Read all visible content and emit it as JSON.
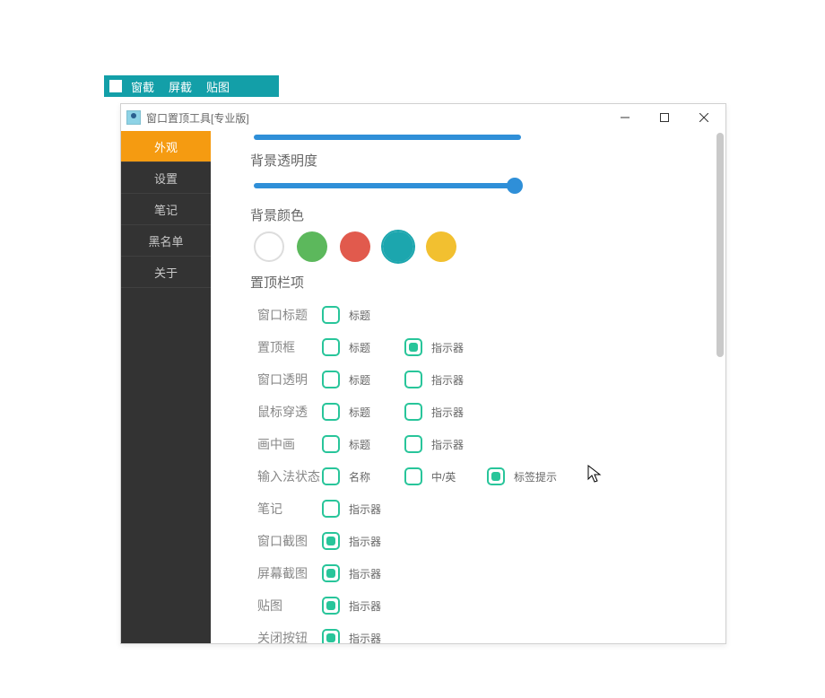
{
  "toolbar": {
    "items": [
      "窗截",
      "屏截",
      "贴图"
    ]
  },
  "window": {
    "title": "窗口置顶工具[专业版]"
  },
  "sidebar": {
    "items": [
      {
        "label": "外观",
        "active": true
      },
      {
        "label": "设置",
        "active": false
      },
      {
        "label": "笔记",
        "active": false
      },
      {
        "label": "黑名单",
        "active": false
      },
      {
        "label": "关于",
        "active": false
      }
    ]
  },
  "content": {
    "slider_bg_opacity_label": "背景透明度",
    "slider_bg_opacity_value": 100,
    "bg_color_label": "背景颜色",
    "colors": {
      "white": "#ffffff",
      "green": "#5cb85c",
      "red": "#e15a4d",
      "teal": "#1ca6ae",
      "yellow": "#f2c030",
      "selected": "teal"
    },
    "topbar_items_label": "置顶栏项",
    "rows": [
      {
        "label": "窗口标题",
        "opts": [
          {
            "label": "标题",
            "checked": false
          }
        ]
      },
      {
        "label": "置顶框",
        "opts": [
          {
            "label": "标题",
            "checked": false
          },
          {
            "label": "指示器",
            "checked": true
          }
        ]
      },
      {
        "label": "窗口透明",
        "opts": [
          {
            "label": "标题",
            "checked": false
          },
          {
            "label": "指示器",
            "checked": false
          }
        ]
      },
      {
        "label": "鼠标穿透",
        "opts": [
          {
            "label": "标题",
            "checked": false
          },
          {
            "label": "指示器",
            "checked": false
          }
        ]
      },
      {
        "label": "画中画",
        "opts": [
          {
            "label": "标题",
            "checked": false
          },
          {
            "label": "指示器",
            "checked": false
          }
        ]
      },
      {
        "label": "输入法状态",
        "opts": [
          {
            "label": "名称",
            "checked": false
          },
          {
            "label": "中/英",
            "checked": false
          },
          {
            "label": "标签提示",
            "checked": true
          }
        ]
      },
      {
        "label": "笔记",
        "opts": [
          {
            "label": "指示器",
            "checked": false
          }
        ]
      },
      {
        "label": "窗口截图",
        "opts": [
          {
            "label": "指示器",
            "checked": true
          }
        ]
      },
      {
        "label": "屏幕截图",
        "opts": [
          {
            "label": "指示器",
            "checked": true
          }
        ]
      },
      {
        "label": "贴图",
        "opts": [
          {
            "label": "指示器",
            "checked": true
          }
        ]
      },
      {
        "label": "关闭按钮",
        "opts": [
          {
            "label": "指示器",
            "checked": true
          }
        ]
      }
    ]
  }
}
